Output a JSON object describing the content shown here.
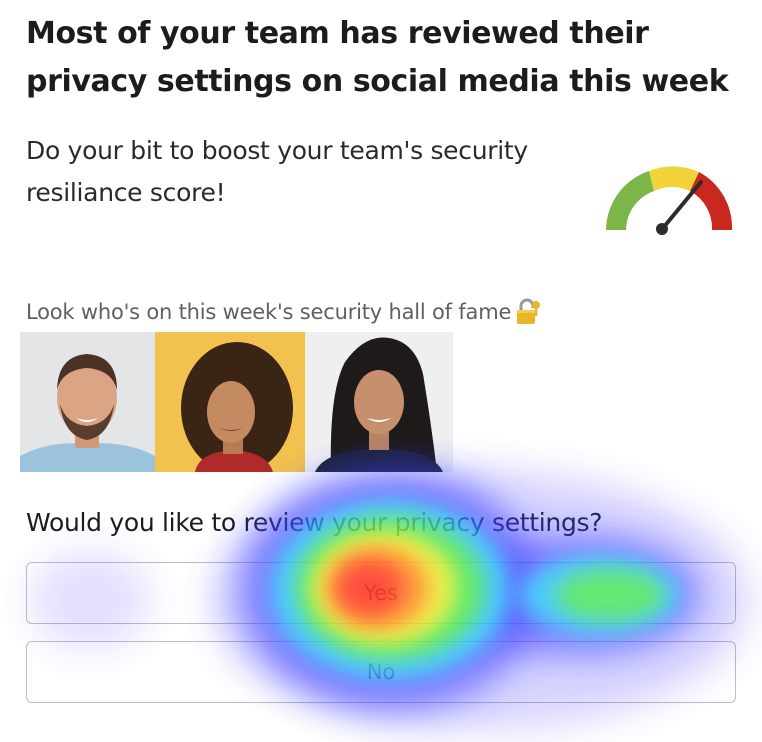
{
  "card": {
    "headline": "Most of your team has reviewed their privacy settings on social media this week",
    "subtext": "Do your bit to boost your team's security resiliance score!",
    "gauge": {
      "icon": "speedometer-gauge-icon",
      "colors": {
        "low": "#7ab648",
        "mid": "#f2d43a",
        "high": "#c8281e",
        "needle": "#2b2b2b"
      }
    },
    "hall_of_fame": {
      "label": "Look who's on this week's security hall of fame",
      "icon": "lock-icon",
      "photos": [
        {
          "name": "hall-of-fame-photo-1"
        },
        {
          "name": "hall-of-fame-photo-2"
        },
        {
          "name": "hall-of-fame-photo-3"
        }
      ]
    },
    "question": "Would you like to review your privacy settings?",
    "buttons": {
      "yes": "Yes",
      "no": "No"
    }
  },
  "overlay": {
    "type": "click-heatmap",
    "colors": [
      "#4a3cff",
      "#27d3ff",
      "#4ee848",
      "#f6ef2a",
      "#ff8a1c",
      "#ff2a1a"
    ]
  }
}
